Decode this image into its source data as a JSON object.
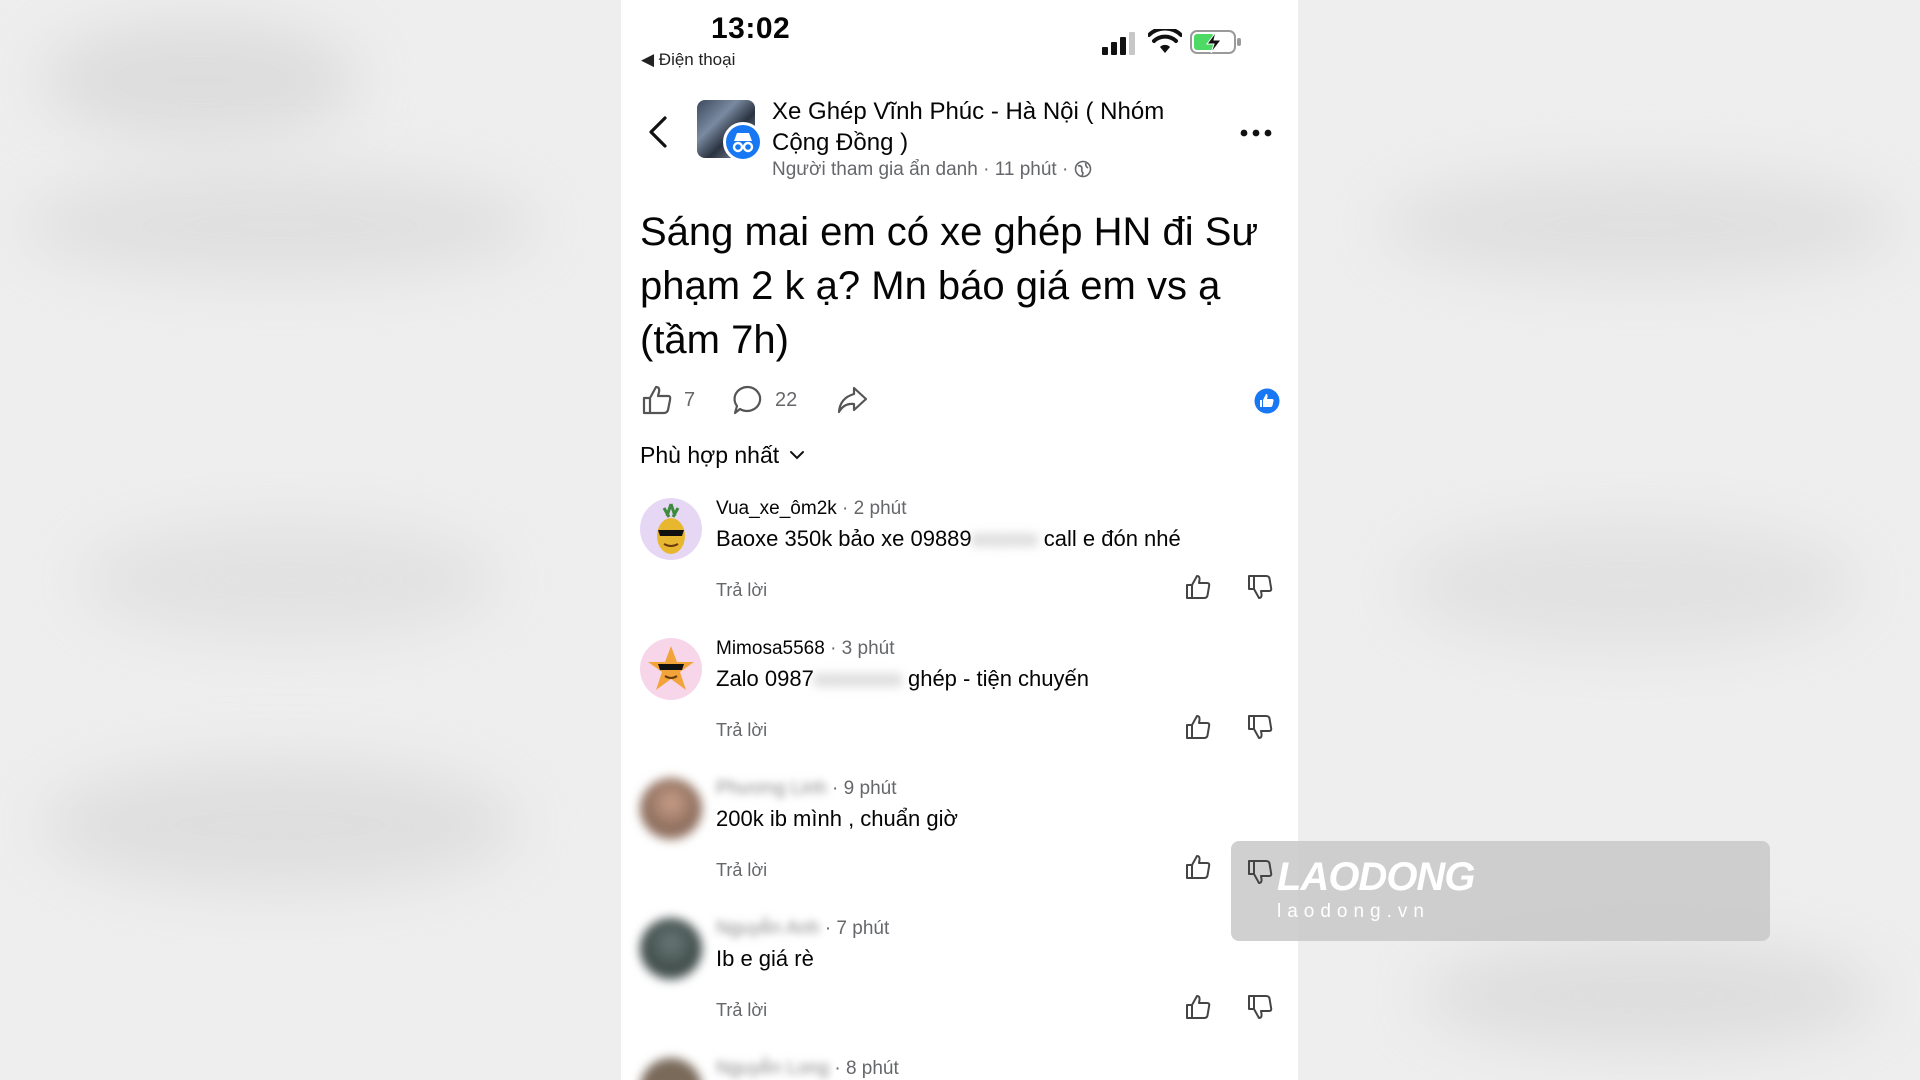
{
  "status_bar": {
    "time": "13:02",
    "back_app": "◀ Điện thoại"
  },
  "post": {
    "group_name": "Xe Ghép Vĩnh Phúc - Hà Nội ( Nhóm Cộng Đồng )",
    "author": "Người tham gia ẩn danh",
    "time": "11 phút",
    "text": "Sáng mai em có xe ghép HN đi Sư phạm 2 k ạ? Mn báo giá em vs ạ (tầm 7h)",
    "likes": "7",
    "comments_count": "22"
  },
  "sort": {
    "label": "Phù hợp nhất"
  },
  "comments": [
    {
      "name": "Vua_xe_ôm2k",
      "time": "2 phút",
      "text": "Baoxe 350k bảo xe 09889",
      "redacted": "xxxxxx",
      "text_after": " call e đón nhé",
      "reply": "Trả lời"
    },
    {
      "name": "Mimosa5568",
      "time": "3 phút",
      "text": "Zalo 0987",
      "redacted": "xxxxxxxx",
      "text_after": " ghép - tiện chuyến",
      "reply": "Trả lời"
    },
    {
      "name": "Phương Linh",
      "time": "9 phút",
      "text": "200k ib mình , chuẩn giờ",
      "reply": "Trả lời"
    },
    {
      "name": "Nguyễn Anh",
      "time": "7 phút",
      "text": "Ib e giá rè",
      "reply": "Trả lời"
    },
    {
      "name": "Nguyễn Long",
      "time": "8 phút"
    }
  ],
  "watermark": {
    "brand": "LAODONG",
    "url": "laodong.vn"
  },
  "colors": {
    "accent": "#1877f2",
    "secondary_text": "#65676b",
    "battery": "#4cd964"
  }
}
